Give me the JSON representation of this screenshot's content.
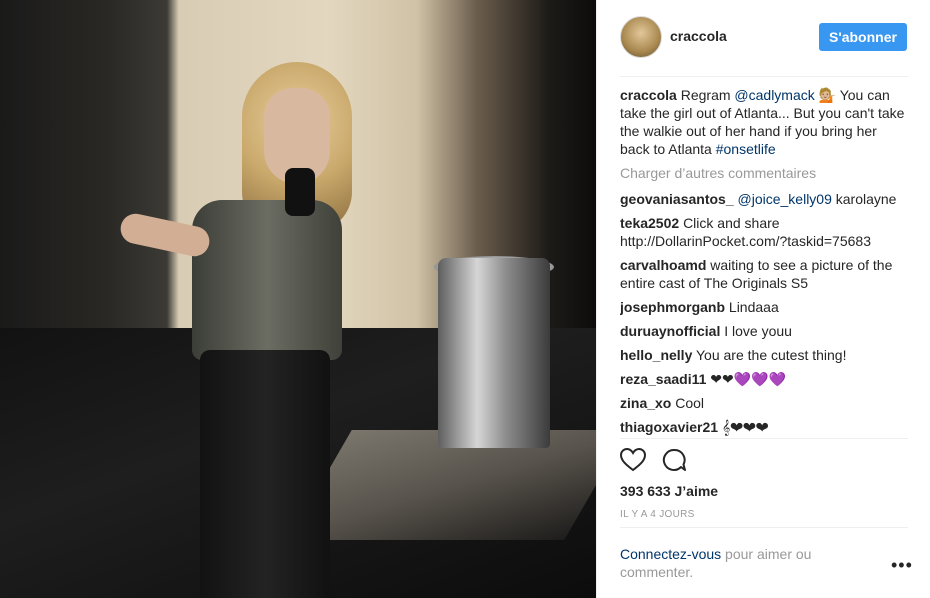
{
  "post": {
    "username": "craccola",
    "follow_label": "S'abonner",
    "caption": {
      "user": "craccola",
      "text_before": "Regram ",
      "mention": "@cadlymack",
      "emoji": "💁🏼",
      "text_after": " You can take the girl out of Atlanta... But you can't take the walkie out of her hand if you bring her back to Atlanta ",
      "hashtag": "#onsetlife"
    },
    "load_more_label": "Charger d’autres commentaires",
    "comments": [
      {
        "user": "geovaniasantos_",
        "mention": "@joice_kelly09",
        "text": " karolayne"
      },
      {
        "user": "teka2502",
        "mention": "",
        "text": "Click and share http://DollarinPocket.com/?taskid=75683"
      },
      {
        "user": "carvalhoamd",
        "mention": "",
        "text": "waiting to see a picture of the entire cast of The Originals S5"
      },
      {
        "user": "josephmorganb",
        "mention": "",
        "text": "Lindaaa"
      },
      {
        "user": "duruaynofficial",
        "mention": "",
        "text": "I love youu"
      },
      {
        "user": "hello_nelly",
        "mention": "",
        "text": "You are the cutest thing!"
      },
      {
        "user": "reza_saadi11",
        "mention": "",
        "text": "❤❤💜💜💜"
      },
      {
        "user": "zina_xo",
        "mention": "",
        "text": "Cool"
      },
      {
        "user": "thiagoxavier21",
        "mention": "",
        "text": "𝄞❤❤❤"
      }
    ],
    "likes": "393 633 J’aime",
    "time": "IL Y A 4 JOURS",
    "login_prompt": {
      "link": "Connectez-vous",
      "rest": " pour aimer ou commenter."
    },
    "more_options": "•••"
  },
  "icons": {
    "like": "heart-icon",
    "comment": "comment-bubble-icon",
    "options": "ellipsis-icon"
  },
  "colors": {
    "accent": "#3897f0",
    "link": "#003569",
    "muted": "#999999"
  }
}
